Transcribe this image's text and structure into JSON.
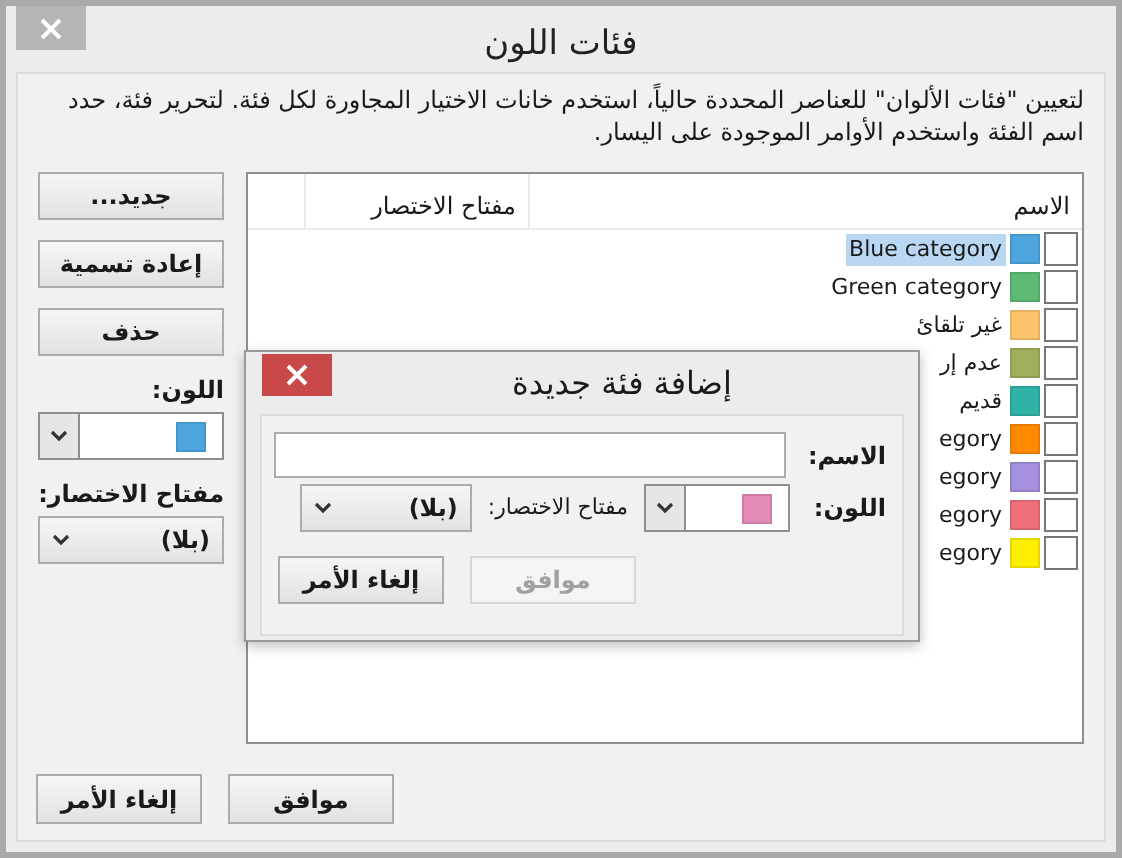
{
  "window": {
    "title": "فئات اللون"
  },
  "instructions": "لتعيين \"فئات الألوان\" للعناصر المحددة حالياً، استخدم خانات الاختيار المجاورة لكل فئة. لتحرير فئة، حدد اسم الفئة واستخدم الأوامر الموجودة على اليسار.",
  "list": {
    "columns": [
      "الاسم",
      "مفتاح الاختصار"
    ],
    "rows": [
      {
        "name": "Blue category",
        "color": "#4ea6e0",
        "checked": false,
        "selected": true
      },
      {
        "name": "Green category",
        "color": "#5dbb74",
        "checked": false,
        "selected": false
      },
      {
        "name": "غير تلقائ",
        "color": "#fcc56b",
        "checked": false,
        "selected": false
      },
      {
        "name": "عدم إر",
        "color": "#9fb05c",
        "checked": false,
        "selected": false
      },
      {
        "name": "قديم",
        "color": "#2fb3a6",
        "checked": false,
        "selected": false
      },
      {
        "name": "egory",
        "color": "#ff8a00",
        "checked": false,
        "selected": false
      },
      {
        "name": "egory",
        "color": "#a490dc",
        "checked": false,
        "selected": false
      },
      {
        "name": "egory",
        "color": "#ef6f7a",
        "checked": false,
        "selected": false
      },
      {
        "name": "egory",
        "color": "#ffee00",
        "checked": false,
        "selected": false
      }
    ]
  },
  "side_buttons": [
    "جديد...",
    "إعادة تسمية",
    "حذف"
  ],
  "color_label": "اللون:",
  "color_picker": {
    "color": "#4ea6e0"
  },
  "shortcut_label": "مفتاح الاختصار:",
  "shortcut_dropdown": {
    "value": "(بلا)"
  },
  "buttons": [
    {
      "label": "موافق"
    },
    {
      "label": "إلغاء الأمر"
    }
  ],
  "add_dialog": {
    "title": "إضافة فئة جديدة",
    "name_label": "الاسم:",
    "color_label": "اللون:",
    "color": "#e58bb9",
    "shortcut_label": "مفتاح الاختصار:",
    "shortcut_value": "(بلا)",
    "buttons": [
      {
        "label": "موافق",
        "disabled": true
      },
      {
        "label": "إلغاء الأمر",
        "disabled": false
      }
    ]
  }
}
